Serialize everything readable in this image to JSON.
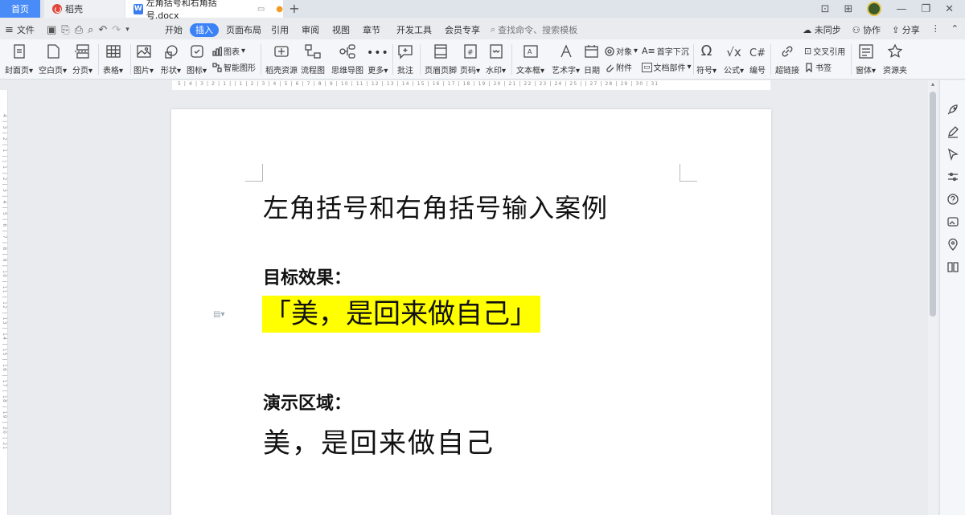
{
  "tabs": {
    "home": "首页",
    "daoke": "稻壳",
    "doc": "左角括号和右角括号.docx"
  },
  "menu": {
    "file": "文件",
    "ribbon_tabs": [
      "开始",
      "插入",
      "页面布局",
      "引用",
      "审阅",
      "视图",
      "章节",
      "开发工具",
      "会员专享"
    ],
    "active_tab": "插入",
    "search_placeholder": "查找命令、搜索模板",
    "sync": "未同步",
    "collab": "协作",
    "share": "分享"
  },
  "ribbon": {
    "cover": "封面页",
    "blank": "空白页",
    "pagebreak": "分页",
    "table": "表格",
    "picture": "图片",
    "shape": "形状",
    "icons": "图标",
    "chart": "图表",
    "smartart": "智能图形",
    "daoke_res": "稻壳资源",
    "flowchart": "流程图",
    "mindmap": "思维导图",
    "more": "更多",
    "comment": "批注",
    "header_footer": "页眉页脚",
    "page_num": "页码",
    "watermark": "水印",
    "textbox": "文本框",
    "wordart": "艺术字",
    "date": "日期",
    "object": "对象",
    "dropcap": "首字下沉",
    "attachment": "附件",
    "docparts": "文档部件",
    "symbol": "符号",
    "formula": "公式",
    "numbering": "编号",
    "crossref": "交叉引用",
    "hyperlink": "超链接",
    "bookmark": "书签",
    "window": "窗体",
    "resource": "资源夹"
  },
  "ruler": {
    "h_ticks": "5 | 4 | 3 | 2 | 1 |   | 1 | 2 | 3 | 4 | 5 | 6 | 7 | 8 | 9 | 10 | 11 | 12 | 13 | 14 | 15 | 16 | 17 | 18 | 19 | 20 | 21 | 22 | 23 | 24 | 25 |   | 27 | 28 | 29 | 30 | 31",
    "v_ticks": "4 | 3 | 2 | 1 |   | 1 | 2 | 3 | 4 | 5 | 6 | 7 | 8 | 9 | 10 | 11 | 12 | 13 | 14 | 15 | 16 | 17 | 18 | 19 | 20 | 21"
  },
  "document": {
    "title": "左角括号和右角括号输入案例",
    "heading_target": "目标效果：",
    "target_text": "「美，是回来做自己」",
    "heading_demo": "演示区域：",
    "demo_text": "美，是回来做自己"
  },
  "colors": {
    "accent": "#3b82f6",
    "highlight": "#ffff00"
  }
}
